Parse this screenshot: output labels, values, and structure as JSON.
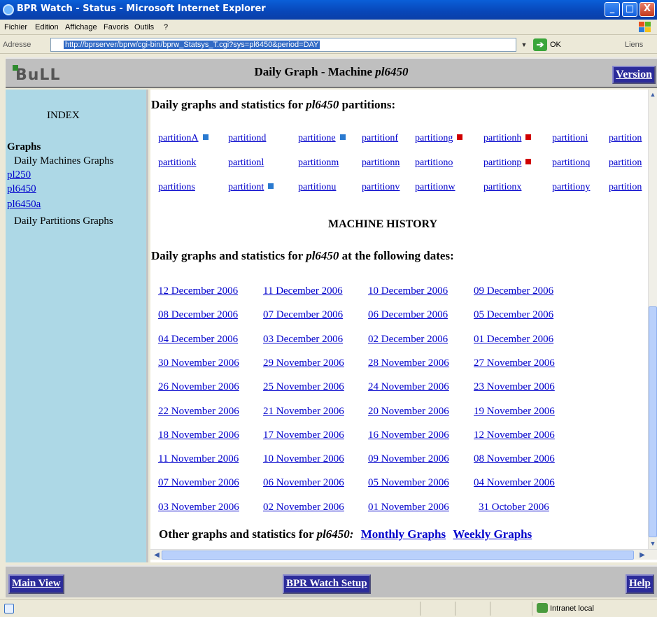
{
  "window": {
    "title": "BPR Watch - Status - Microsoft Internet Explorer",
    "minimize_glyph": "_",
    "maximize_glyph": "□",
    "close_glyph": "X"
  },
  "menu": [
    "Fichier",
    "Edition",
    "Affichage",
    "Favoris",
    "Outils",
    "?"
  ],
  "address": {
    "label": "Adresse",
    "url": "http://bprserver/bprw/cgi-bin/bprw_Statsys_T.cgi?sys=pl6450&period=DAY",
    "go_label": "OK",
    "links_label": "Liens"
  },
  "top_frame": {
    "logo_text": "BuLL",
    "title_prefix": "Daily Graph - Machine ",
    "title_machine": "pl6450",
    "version_label": "Version"
  },
  "sidebar": {
    "index_title": "INDEX",
    "graphs_header": "Graphs",
    "daily_machines": "Daily Machines Graphs",
    "machines": [
      "pl250",
      "pl6450",
      "pl6450a"
    ],
    "daily_partitions": "Daily Partitions Graphs"
  },
  "main": {
    "partitions_heading_prefix": "Daily graphs and statistics for ",
    "partitions_heading_machine": "pl6450",
    "partitions_heading_suffix": " partitions:",
    "partition_rows": [
      [
        {
          "label": "partitionA",
          "marker": "blue"
        },
        {
          "label": "partitiond",
          "marker": ""
        },
        {
          "label": "partitione",
          "marker": "blue"
        },
        {
          "label": "partitionf",
          "marker": ""
        },
        {
          "label": "partitiong",
          "marker": "red"
        },
        {
          "label": "partitionh",
          "marker": "red"
        },
        {
          "label": "partitioni",
          "marker": ""
        },
        {
          "label": "partition",
          "marker": ""
        }
      ],
      [
        {
          "label": "partitionk",
          "marker": ""
        },
        {
          "label": "partitionl",
          "marker": ""
        },
        {
          "label": "partitionm",
          "marker": ""
        },
        {
          "label": "partitionn",
          "marker": ""
        },
        {
          "label": "partitiono",
          "marker": ""
        },
        {
          "label": "partitionp",
          "marker": "red"
        },
        {
          "label": "partitionq",
          "marker": ""
        },
        {
          "label": "partition",
          "marker": ""
        }
      ],
      [
        {
          "label": "partitions",
          "marker": ""
        },
        {
          "label": "partitiont",
          "marker": "blue"
        },
        {
          "label": "partitionu",
          "marker": ""
        },
        {
          "label": "partitionv",
          "marker": ""
        },
        {
          "label": "partitionw",
          "marker": ""
        },
        {
          "label": "partitionx",
          "marker": ""
        },
        {
          "label": "partitiony",
          "marker": ""
        },
        {
          "label": "partition",
          "marker": ""
        }
      ]
    ],
    "history_title": "MACHINE HISTORY",
    "dates_heading_prefix": "Daily graphs and statistics for ",
    "dates_heading_machine": "pl6450",
    "dates_heading_suffix": " at the following dates:",
    "date_rows": [
      [
        "12 December 2006",
        "11 December 2006",
        "10 December 2006",
        "09 December 2006"
      ],
      [
        "08 December 2006",
        "07 December 2006",
        "06 December 2006",
        "05 December 2006"
      ],
      [
        "04 December 2006",
        "03 December 2006",
        "02 December 2006",
        "01 December 2006"
      ],
      [
        "30 November 2006",
        "29 November 2006",
        "28 November 2006",
        "27 November 2006"
      ],
      [
        "26 November 2006",
        "25 November 2006",
        "24 November 2006",
        "23 November 2006"
      ],
      [
        "22 November 2006",
        "21 November 2006",
        "20 November 2006",
        "19 November 2006"
      ],
      [
        "18 November 2006",
        "17 November 2006",
        "16 November 2006",
        "12 November 2006"
      ],
      [
        "11 November 2006",
        "10 November 2006",
        "09 November 2006",
        "08 November 2006"
      ],
      [
        "07 November 2006",
        "06 November 2006",
        "05 November 2006",
        "04 November 2006"
      ],
      [
        "03 November 2006",
        "02 November 2006",
        "01 November 2006",
        "31 October 2006"
      ]
    ],
    "other_prefix": "Other graphs and statistics for ",
    "other_machine": "pl6450:",
    "monthly_label": "Monthly Graphs",
    "weekly_label": "Weekly Graphs"
  },
  "bottom_frame": {
    "main_view": "Main View",
    "setup": "BPR Watch Setup",
    "help": "Help"
  },
  "status": {
    "zone": "Intranet local"
  },
  "colors": {
    "sidebar_bg": "#add8e6",
    "link": "#0000cc",
    "marker_blue": "#2a7ad0",
    "marker_red": "#d00000",
    "nav_button": "#2c2c9a"
  }
}
